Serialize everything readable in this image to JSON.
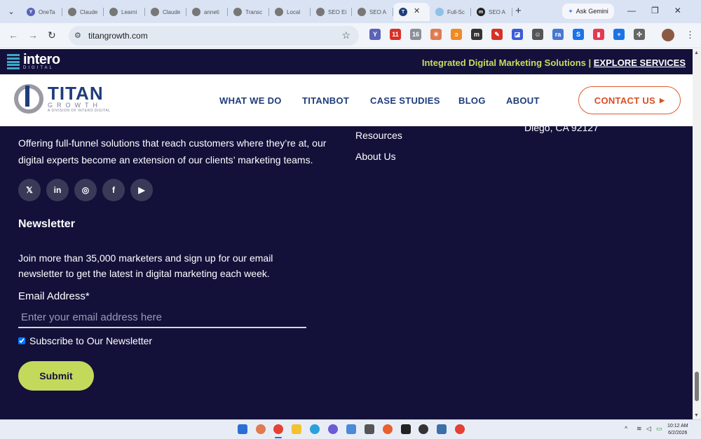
{
  "browser": {
    "tabs": [
      {
        "label": "OneTa",
        "favicon": "Y",
        "color": "#5a63b7"
      },
      {
        "label": "Claude",
        "favicon": "",
        "color": "#777777"
      },
      {
        "label": "Learni",
        "favicon": "",
        "color": "#777777"
      },
      {
        "label": "Claude",
        "favicon": "",
        "color": "#777777"
      },
      {
        "label": "anneti",
        "favicon": "",
        "color": "#777777"
      },
      {
        "label": "Transc",
        "favicon": "",
        "color": "#777777"
      },
      {
        "label": "Local",
        "favicon": "",
        "color": "#777777"
      },
      {
        "label": "SEO Ei",
        "favicon": "",
        "color": "#777777"
      },
      {
        "label": "SEO A",
        "favicon": "",
        "color": "#777777"
      },
      {
        "label": "",
        "favicon": "T",
        "color": "#1e3d7a",
        "active": true
      },
      {
        "label": "Full-Sc",
        "favicon": "",
        "color": "#8fc0e8"
      },
      {
        "label": "SEO A",
        "favicon": "m",
        "color": "#222222"
      }
    ],
    "close_tab": "✕",
    "new_tab": "+",
    "ask_gemini": "Ask Gemini",
    "window_controls": {
      "minimize": "—",
      "maximize": "❐",
      "close": "✕"
    },
    "url": "titangrowth.com",
    "extensions": [
      {
        "name": "onetab-extension",
        "glyph": "Y",
        "bg": "#5a63b7"
      },
      {
        "name": "pdf-extension",
        "glyph": "11",
        "bg": "#d93025"
      },
      {
        "name": "home-extension",
        "glyph": "16",
        "bg": "#8a8f99"
      },
      {
        "name": "claude-extension",
        "glyph": "✳",
        "bg": "#e07a4f"
      },
      {
        "name": "loop-extension",
        "glyph": "ɔ",
        "bg": "#f08a24"
      },
      {
        "name": "m-extension",
        "glyph": "m",
        "bg": "#333333"
      },
      {
        "name": "notes-extension",
        "glyph": "✎",
        "bg": "#d93025"
      },
      {
        "name": "screen-extension",
        "glyph": "◪",
        "bg": "#3b5bd9"
      },
      {
        "name": "refresh-extension",
        "glyph": "☺",
        "bg": "#555555"
      },
      {
        "name": "ra-extension",
        "glyph": "ra",
        "bg": "#4a78d0"
      },
      {
        "name": "s-extension",
        "glyph": "S",
        "bg": "#1a73e8"
      },
      {
        "name": "red-extension",
        "glyph": "▮",
        "bg": "#e53950"
      },
      {
        "name": "plus-extension",
        "glyph": "+",
        "bg": "#1a73e8"
      },
      {
        "name": "puzzle-extension",
        "glyph": "✣",
        "bg": "#666666"
      }
    ]
  },
  "site": {
    "topbar": {
      "logo_word": "intero",
      "logo_sub": "DIGITAL",
      "tagline": "Integrated Digital Marketing Solutions | ",
      "explore": "EXPLORE SERVICES"
    },
    "logo": {
      "name": "TITAN",
      "growth": "GROWTH",
      "sub": "A DIVISION OF INTERO DIGITAL"
    },
    "nav": [
      "WHAT WE DO",
      "TITANBOT",
      "CASE STUDIES",
      "BLOG",
      "ABOUT"
    ],
    "contact": "CONTACT US"
  },
  "footer": {
    "about": "Offering full-funnel solutions that reach customers where they’re at, our digital experts become an extension of our clients’ marketing teams.",
    "links": [
      "Resources",
      "About Us"
    ],
    "address": "Diego, CA 92127",
    "socials": [
      {
        "name": "twitter",
        "glyph": "𝕏"
      },
      {
        "name": "linkedin",
        "glyph": "in"
      },
      {
        "name": "instagram",
        "glyph": "◎"
      },
      {
        "name": "facebook",
        "glyph": "f"
      },
      {
        "name": "youtube",
        "glyph": "▶"
      }
    ],
    "newsletter": {
      "heading": "Newsletter",
      "description": "Join more than 35,000 marketers and sign up for our email newsletter to get the latest in digital marketing each week.",
      "email_label": "Email Address*",
      "email_placeholder": "Enter your email address here",
      "email_value": "",
      "subscribe_label": "Subscribe to Our Newsletter",
      "subscribe_checked": true,
      "submit": "Submit"
    }
  },
  "taskbar": {
    "time": "10:12 AM",
    "date": "6/2/2026",
    "tray_chevron": "^",
    "tray_wifi": "📶"
  },
  "colors": {
    "page_bg": "#13113a",
    "accent_green": "#c3d95c",
    "brand_blue": "#1e3d7a",
    "contact_orange": "#d94e1f"
  }
}
